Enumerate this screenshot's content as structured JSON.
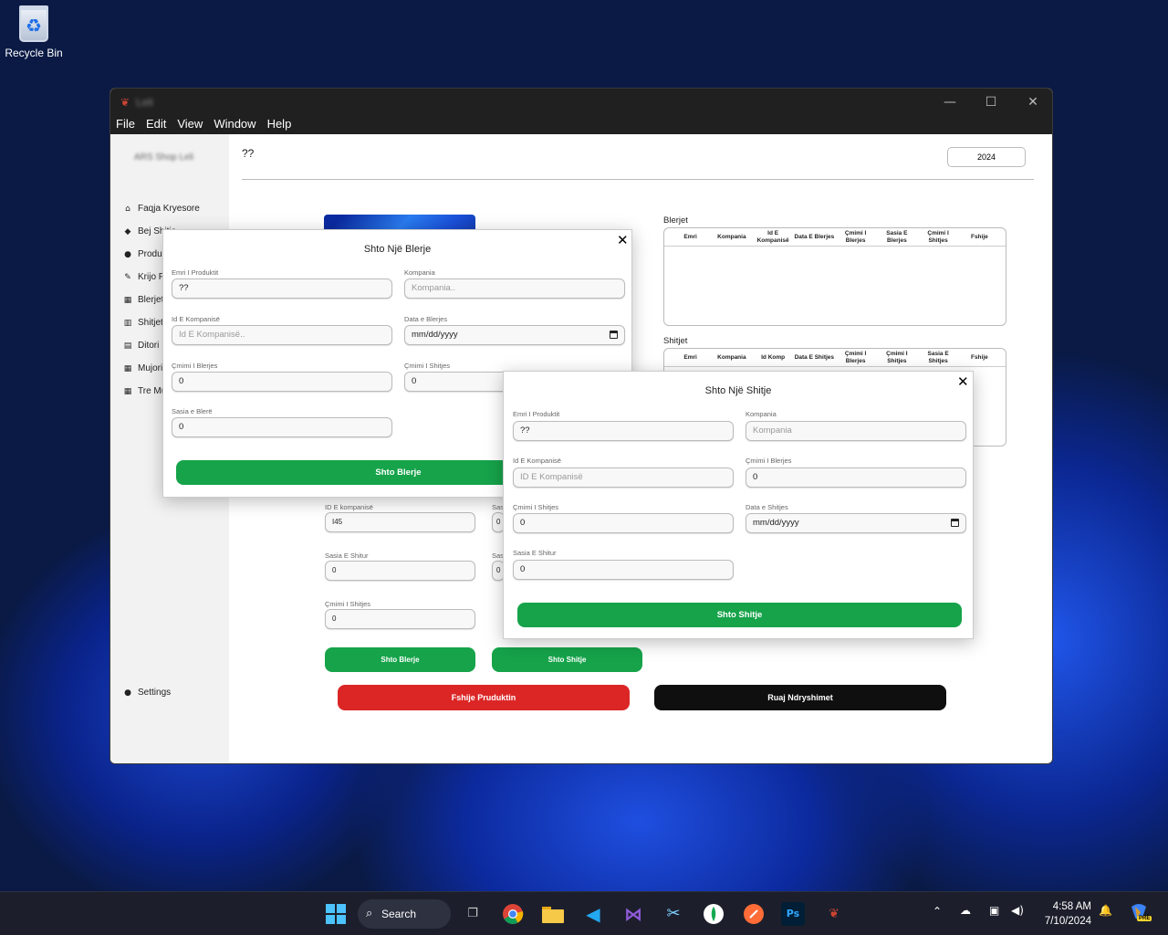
{
  "desktop": {
    "recycle_bin_label": "Recycle Bin"
  },
  "window": {
    "title": "Leli",
    "controls": {
      "minimize": "—",
      "maximize": "☐",
      "close": "✕"
    },
    "menu": [
      "File",
      "Edit",
      "View",
      "Window",
      "Help"
    ]
  },
  "sidebar": {
    "brand": "ARS Shop Leli",
    "items": [
      {
        "label": "Faqja Kryesore",
        "icon": "home-icon"
      },
      {
        "label": "Bej Shitje",
        "icon": "tag-icon"
      },
      {
        "label": "Produktet",
        "icon": "box-icon"
      },
      {
        "label": "Krijo Produkt",
        "icon": "edit-icon"
      },
      {
        "label": "Blerjet",
        "icon": "chart-icon"
      },
      {
        "label": "Shitjet",
        "icon": "bar-chart-icon"
      },
      {
        "label": "Ditori",
        "icon": "calendar-icon"
      },
      {
        "label": "Mujori",
        "icon": "calendar-icon"
      },
      {
        "label": "Tre Mujori",
        "icon": "calendar-icon"
      }
    ],
    "settings": "Settings"
  },
  "main": {
    "title": "??",
    "year": "2024",
    "form": {
      "company_id_label": "ID E kompanisë",
      "company_id_value": "I45",
      "qty_sold_label": "Sasia E Shitur",
      "qty_sold_value": "0",
      "sale_price_label": "Çmimi I Shitjes",
      "sale_price_value": "0",
      "col2_label_1": "Sas",
      "col2_label_2": "Sas",
      "col2_value_1": "0",
      "col2_value_2": "0"
    },
    "buttons": {
      "add_purchase": "Shto Blerje",
      "add_sale": "Shto Shitje",
      "delete_product": "Fshije Pruduktin",
      "save_changes": "Ruaj Ndryshimet"
    },
    "purchases_table": {
      "title": "Blerjet",
      "headers": [
        "Emri",
        "Kompania",
        "Id E Kompanisë",
        "Data E Blerjes",
        "Çmimi I Blerjes",
        "Sasia E Blerjes",
        "Çmimi I Shitjes",
        "Fshije"
      ]
    },
    "sales_table": {
      "title": "Shitjet",
      "headers": [
        "Emri",
        "Kompania",
        "Id Komp",
        "Data E Shitjes",
        "Çmimi I Blerjes",
        "Çmimi I Shitjes",
        "Sasia E Shitjes",
        "Fshije"
      ]
    }
  },
  "purchase_dialog": {
    "title": "Shto Një Blerje",
    "close": "✕",
    "product_name_label": "Emri I Produktit",
    "product_name_value": "??",
    "company_label": "Kompania",
    "company_placeholder": "Kompania..",
    "company_id_label": "Id E Kompanisë",
    "company_id_placeholder": "Id E Kompanisë..",
    "purchase_date_label": "Data e Blerjes",
    "purchase_date_value": "mm/dd/yyyy",
    "purchase_price_label": "Çmimi I Blerjes",
    "purchase_price_value": "0",
    "sale_price_label": "Çmimi I Shitjes",
    "sale_price_value": "0",
    "qty_label": "Sasia e Blerë",
    "qty_value": "0",
    "submit": "Shto Blerje"
  },
  "sale_dialog": {
    "title": "Shto Një Shitje",
    "close": "✕",
    "product_name_label": "Emri I Produktit",
    "product_name_value": "??",
    "company_label": "Kompania",
    "company_placeholder": "Kompania",
    "company_id_label": "Id E Kompanisë",
    "company_id_placeholder": "ID E Kompanisë",
    "purchase_price_label": "Çmimi I Blerjes",
    "purchase_price_value": "0",
    "sale_price_label": "Çmimi I Shitjes",
    "sale_price_value": "0",
    "sale_date_label": "Data e Shitjes",
    "sale_date_value": "mm/dd/yyyy",
    "qty_label": "Sasia E Shitur",
    "qty_value": "0",
    "submit": "Shto Shitje"
  },
  "taskbar": {
    "search_label": "Search",
    "apps": [
      "windows-start",
      "task-view",
      "chrome",
      "file-explorer",
      "vscode",
      "visual-studio",
      "snipping-tool",
      "mongodb-compass",
      "postman",
      "photoshop",
      "leli-app"
    ],
    "ps_label": "Ps",
    "time": "4:58 AM",
    "date": "7/10/2024",
    "copilot_badge": "PRE"
  }
}
